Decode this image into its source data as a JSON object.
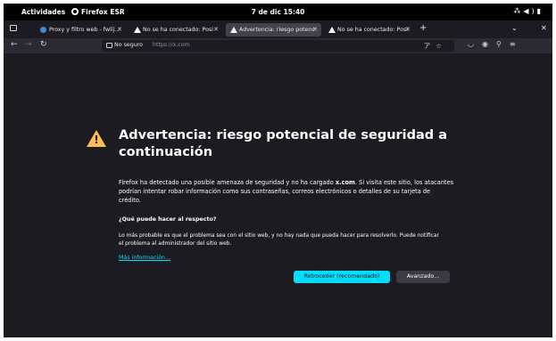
{
  "topbar": {
    "activities": "Actividades",
    "app_name": "Firefox ESR",
    "clock": "7 de dic  15:40",
    "tray_icons": [
      "network-icon",
      "volume-icon",
      "battery-icon"
    ]
  },
  "tabs": [
    {
      "title": "Proxy y filtro web - fwlij...",
      "icon": "globe-icon",
      "active": false
    },
    {
      "title": "No se ha conectado: Posi",
      "icon": "warning-icon",
      "active": false
    },
    {
      "title": "Advertencia: riesgo potenc",
      "icon": "warning-icon",
      "active": true
    },
    {
      "title": "No se ha conectado: Posi",
      "icon": "warning-icon",
      "active": false
    }
  ],
  "urlbar": {
    "security_label": "No seguro",
    "url": "https://x.com"
  },
  "error": {
    "title": "Advertencia: riesgo potencial de seguridad a continuación",
    "desc_before": "Firefox ha detectado una posible amenaza de seguridad y no ha cargado ",
    "desc_domain": "x.com",
    "desc_after": ". Si visita este sitio, los atacantes podrían intentar robar información como sus contraseñas, correos electrónicos o detalles de su tarjeta de crédito.",
    "subheading": "¿Qué puede hacer al respecto?",
    "advice": "Lo más probable es que el problema sea con el sitio web, y no hay nada que pueda hacer para resolverlo. Puede notificar el problema al administrador del sitio web.",
    "more_info": "Más información...",
    "back_button": "Retroceder (recomendado)",
    "advanced_button": "Avanzado..."
  },
  "colors": {
    "page_bg": "#1c1b22",
    "accent": "#00ddff",
    "warning": "#ffbd4f"
  }
}
